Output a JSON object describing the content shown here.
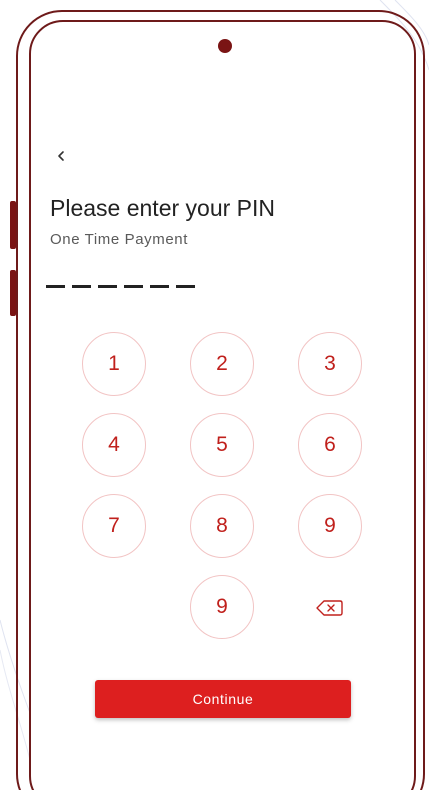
{
  "screen": {
    "title": "Please enter your PIN",
    "subtitle": "One Time Payment",
    "pin_length": 6,
    "pin_filled": 0
  },
  "keypad": {
    "keys": [
      "1",
      "2",
      "3",
      "4",
      "5",
      "6",
      "7",
      "8",
      "9",
      "9"
    ]
  },
  "actions": {
    "continue_label": "Continue"
  },
  "icons": {
    "back": "chevron-left-icon",
    "backspace": "backspace-icon"
  },
  "colors": {
    "accent": "#dd1f1f",
    "key_border": "#f2c4c4",
    "key_text": "#c0201c",
    "phone_frame": "#6e1a1a"
  }
}
